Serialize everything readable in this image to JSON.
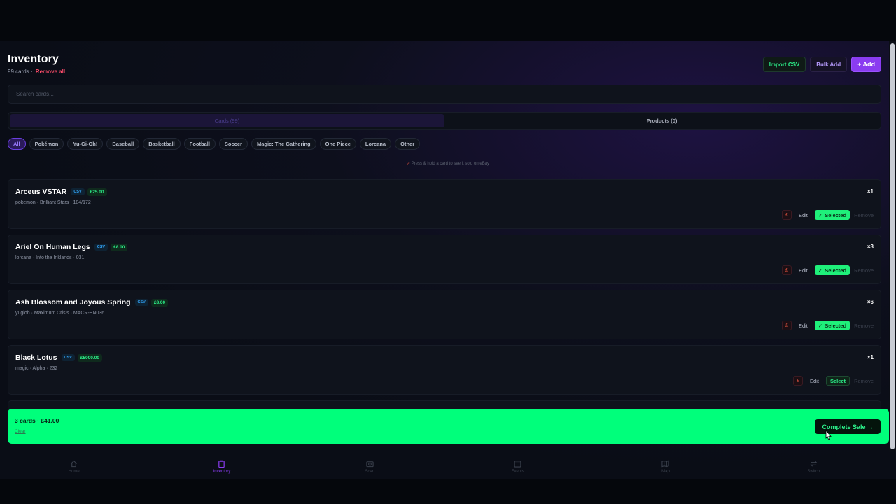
{
  "header": {
    "title": "Inventory",
    "count_text": "99 cards · ",
    "remove_all": "Remove all",
    "import_csv": "Import CSV",
    "bulk_add": "Bulk Add",
    "add": "+ Add"
  },
  "search": {
    "placeholder": "Search cards..."
  },
  "tabs": [
    {
      "label": "Cards (99)",
      "active": true
    },
    {
      "label": "Products (0)",
      "active": false
    }
  ],
  "filters": [
    "All",
    "Pokémon",
    "Yu-Gi-Oh!",
    "Baseball",
    "Basketball",
    "Football",
    "Soccer",
    "Magic: The Gathering",
    "One Piece",
    "Lorcana",
    "Other"
  ],
  "hint": {
    "arrow": "↗",
    "text": " Press & hold a card to see it sold on eBay"
  },
  "cards": [
    {
      "name": "Arceus VSTAR",
      "badge": "CSV",
      "price": "£25.00",
      "meta": "pokemon · Brilliant Stars · 184/172",
      "qty": "×1",
      "selected": true
    },
    {
      "name": "Ariel On Human Legs",
      "badge": "CSV",
      "price": "£8.00",
      "meta": "lorcana · Into the Inklands · 031",
      "qty": "×3",
      "selected": true
    },
    {
      "name": "Ash Blossom and Joyous Spring",
      "badge": "CSV",
      "price": "£8.00",
      "meta": "yugioh · Maximum Crisis · MACR-EN036",
      "qty": "×6",
      "selected": true
    },
    {
      "name": "Black Lotus",
      "badge": "CSV",
      "price": "£5000.00",
      "meta": "magic · Alpha · 232",
      "qty": "×1",
      "selected": false
    }
  ],
  "row_actions": {
    "pound": "£",
    "edit": "Edit",
    "selected": "Selected",
    "check": "✓",
    "select": "Select",
    "remove": "Remove"
  },
  "sale": {
    "summary": "3 cards · £41.00",
    "clear": "Clear",
    "complete": "Complete Sale →"
  },
  "nav": [
    {
      "label": "Home",
      "icon": "home-icon",
      "active": false
    },
    {
      "label": "Inventory",
      "icon": "clipboard-icon",
      "active": true
    },
    {
      "label": "Scan",
      "icon": "camera-icon",
      "active": false
    },
    {
      "label": "Events",
      "icon": "calendar-icon",
      "active": false
    },
    {
      "label": "Map",
      "icon": "map-icon",
      "active": false
    },
    {
      "label": "Switch",
      "icon": "switch-icon",
      "active": false
    }
  ],
  "colors": {
    "accent": "#8a3cf0",
    "success": "#00ff7b",
    "danger": "#ff4d6b",
    "csv": "#34a9ff"
  }
}
